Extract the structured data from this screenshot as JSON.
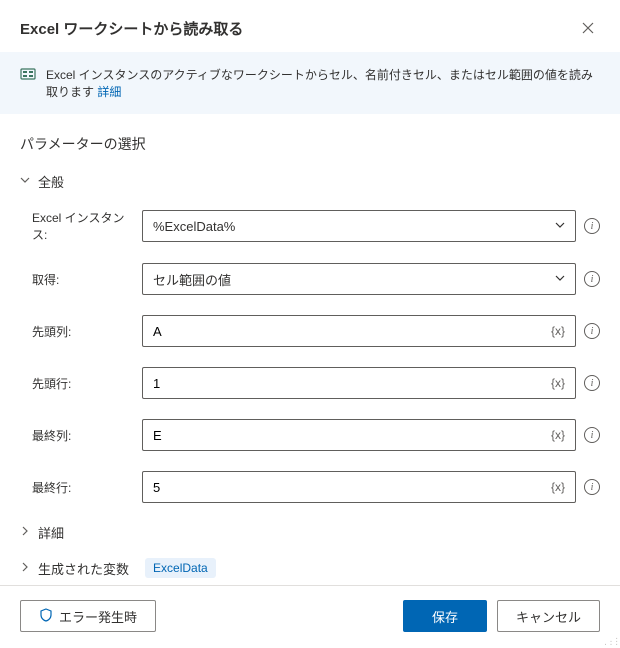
{
  "header": {
    "title": "Excel ワークシートから読み取る"
  },
  "info": {
    "text": "Excel インスタンスのアクティブなワークシートからセル、名前付きセル、またはセル範囲の値を読み取ります ",
    "link": "詳細"
  },
  "sectionTitle": "パラメーターの選択",
  "general": {
    "label": "全般",
    "fields": {
      "instance": {
        "label": "Excel インスタンス:",
        "value": "%ExcelData%"
      },
      "retrieve": {
        "label": "取得:",
        "value": "セル範囲の値"
      },
      "startCol": {
        "label": "先頭列:",
        "value": "A"
      },
      "startRow": {
        "label": "先頭行:",
        "value": "1"
      },
      "endCol": {
        "label": "最終列:",
        "value": "E"
      },
      "endRow": {
        "label": "最終行:",
        "value": "5"
      }
    }
  },
  "varToken": "{x}",
  "advanced": {
    "label": "詳細"
  },
  "generatedVars": {
    "label": "生成された変数",
    "badge": "ExcelData"
  },
  "footer": {
    "errorBtn": "エラー発生時",
    "save": "保存",
    "cancel": "キャンセル"
  }
}
